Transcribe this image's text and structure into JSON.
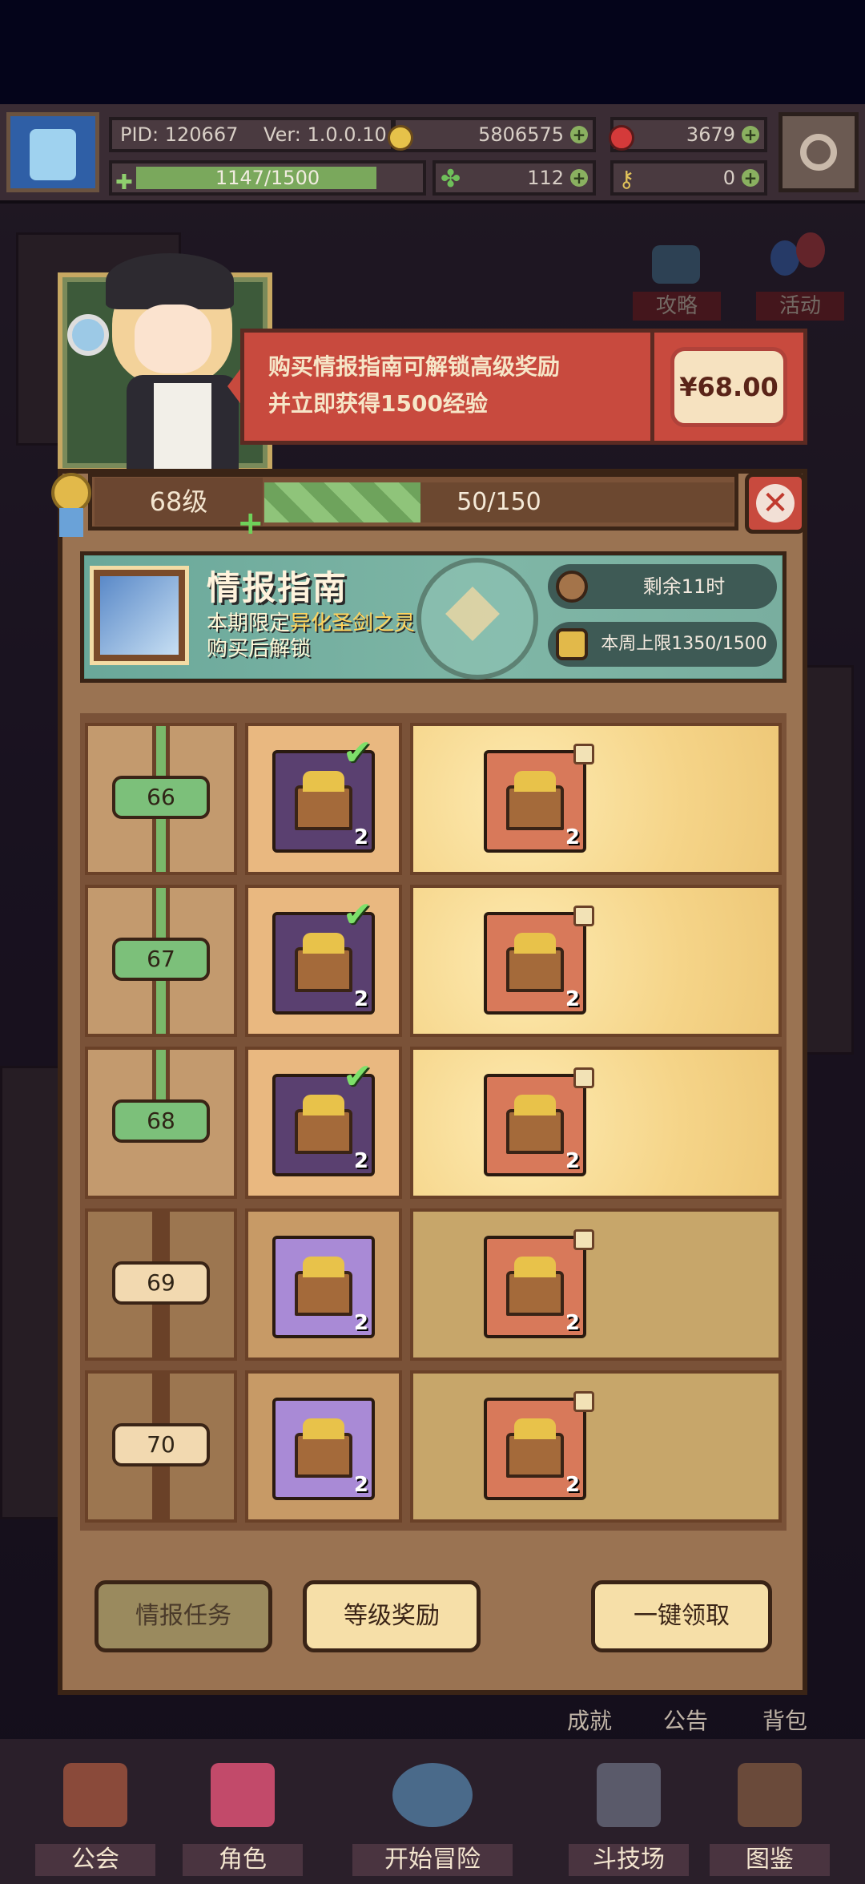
{
  "hud": {
    "pid": "PID: 120667",
    "version": "Ver: 1.0.0.10",
    "gold": "5806575",
    "gems": "3679",
    "exp": "1147/1500",
    "clover": "112",
    "item_count": "0"
  },
  "side_buttons": {
    "strategy": "攻略",
    "event": "活动"
  },
  "banner": {
    "line1": "购买情报指南可解锁高级奖励",
    "line2": "并立即获得1500经验",
    "price": "¥68.00"
  },
  "level": {
    "label": "68级",
    "progress_text": "50/150",
    "progress": 0.333
  },
  "guide": {
    "title": "情报指南",
    "sub_line1_prefix": "本期限定",
    "sub_line1_highlight": "异化圣剑之灵",
    "sub_line2": "购买后解锁",
    "time_left": "剩余11时",
    "weekly_cap": "本周上限1350/1500"
  },
  "rows": [
    {
      "level": "66",
      "free_qty": "2",
      "paid_qty": "2",
      "claimed": true
    },
    {
      "level": "67",
      "free_qty": "2",
      "paid_qty": "2",
      "claimed": true
    },
    {
      "level": "68",
      "free_qty": "2",
      "paid_qty": "2",
      "claimed": true
    },
    {
      "level": "69",
      "free_qty": "2",
      "paid_qty": "2",
      "claimed": false
    },
    {
      "level": "70",
      "free_qty": "2",
      "paid_qty": "2",
      "claimed": false
    }
  ],
  "buttons": {
    "intel_tasks": "情报任务",
    "level_rewards": "等级奖励",
    "claim_all": "一键领取"
  },
  "background_labels": {
    "achievement": "成就",
    "notice": "公告",
    "backpack": "背包"
  },
  "nav": {
    "guild": "公会",
    "character": "角色",
    "start": "开始冒险",
    "arena": "斗技场",
    "codex": "图鉴"
  },
  "colors": {
    "accent_red": "#c84a3e",
    "check_green": "#7de06a",
    "panel_brown": "#9a7352"
  }
}
